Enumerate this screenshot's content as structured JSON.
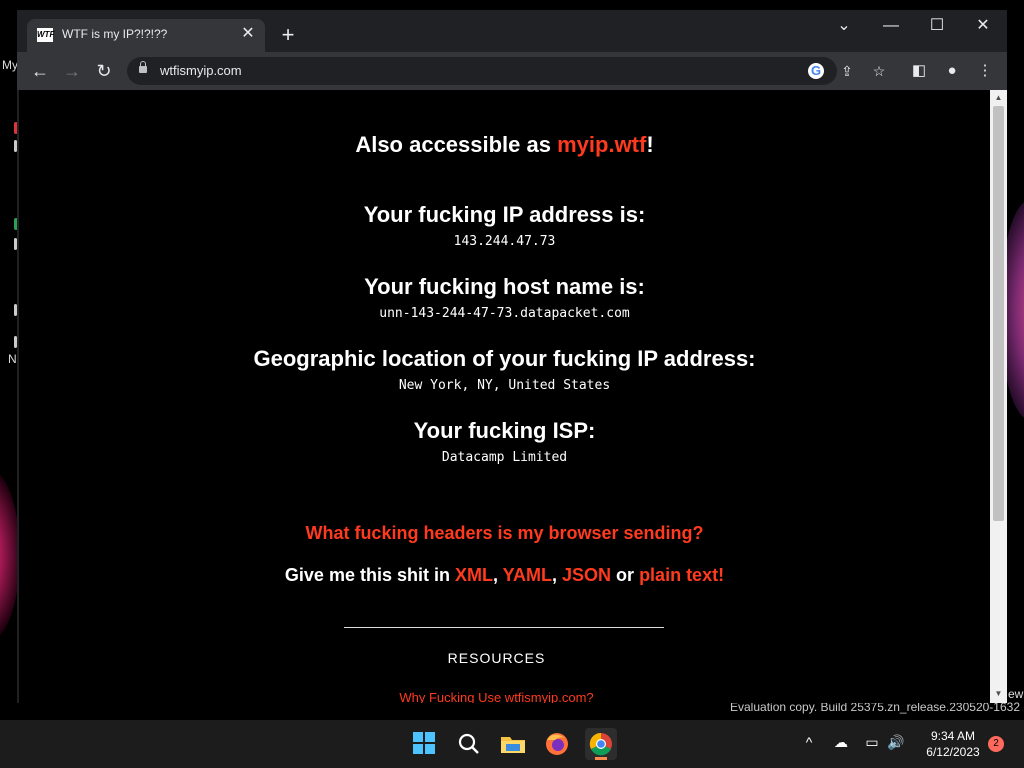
{
  "browser": {
    "tab_title": "WTF is my IP?!?!??",
    "favicon_text": "WTF",
    "url": "wtfismyip.com"
  },
  "page": {
    "also_prefix": "Also accessible as ",
    "also_link": "myip.wtf",
    "also_suffix": "!",
    "ip_heading": "Your fucking IP address is:",
    "ip_value": "143.244.47.73",
    "host_heading": "Your fucking host name is:",
    "host_value": "unn-143-244-47-73.datapacket.com",
    "geo_heading": "Geographic location of your fucking IP address:",
    "geo_value": "New York, NY, United States",
    "isp_heading": "Your fucking ISP:",
    "isp_value": "Datacamp Limited",
    "headers_link": "What fucking headers is my browser sending?",
    "formats_prefix": "Give me this shit in ",
    "format_xml": "XML",
    "format_yaml": "YAML",
    "format_json": "JSON",
    "formats_or": " or ",
    "format_plain": "plain text!",
    "resources_heading": "RESOURCES",
    "why_link": "Why Fucking Use wtfismyip.com?"
  },
  "desktop": {
    "fragment_my": "My",
    "fragment_n": "N",
    "fragment_ew": "ew",
    "watermark": "Evaluation copy. Build 25375.zn_release.230520-1632"
  },
  "taskbar": {
    "time": "9:34 AM",
    "date": "6/12/2023",
    "notification_count": "2"
  },
  "colors": {
    "link_red": "#ff3a1f",
    "windows_blue": "#4cc2ff"
  }
}
